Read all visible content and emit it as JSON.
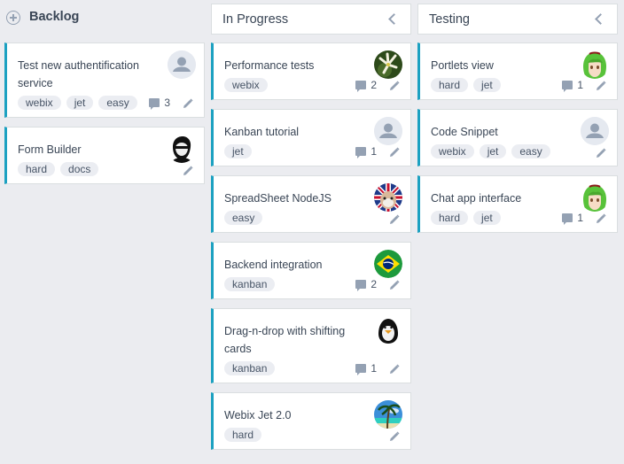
{
  "columns": {
    "backlog": {
      "title": "Backlog",
      "cards": [
        {
          "title": "Test new authentification service",
          "tags": [
            "webix",
            "jet",
            "easy"
          ],
          "comments": "3",
          "avatar": "default-user"
        },
        {
          "title": "Form Builder",
          "tags": [
            "hard",
            "docs"
          ],
          "comments": null,
          "avatar": "user-photo-sunglasses"
        }
      ]
    },
    "in_progress": {
      "title": "In Progress",
      "cards": [
        {
          "title": "Performance tests",
          "tags": [
            "webix"
          ],
          "comments": "2",
          "avatar": "flower-photo"
        },
        {
          "title": "Kanban tutorial",
          "tags": [
            "jet"
          ],
          "comments": "1",
          "avatar": "default-user"
        },
        {
          "title": "SpreadSheet NodeJS",
          "tags": [
            "easy"
          ],
          "comments": null,
          "avatar": "bulldog-photo"
        },
        {
          "title": "Backend integration",
          "tags": [
            "kanban"
          ],
          "comments": "2",
          "avatar": "brazil-flag"
        },
        {
          "title": "Drag-n-drop with shifting cards",
          "tags": [
            "kanban"
          ],
          "comments": "1",
          "avatar": "penguin-photo"
        },
        {
          "title": "Webix Jet 2.0",
          "tags": [
            "hard"
          ],
          "comments": null,
          "avatar": "palm-photo"
        }
      ]
    },
    "testing": {
      "title": "Testing",
      "cards": [
        {
          "title": "Portlets view",
          "tags": [
            "hard",
            "jet"
          ],
          "comments": "1",
          "avatar": "anime-girl"
        },
        {
          "title": "Code Snippet",
          "tags": [
            "webix",
            "jet",
            "easy"
          ],
          "comments": null,
          "avatar": "default-user"
        },
        {
          "title": "Chat app interface",
          "tags": [
            "hard",
            "jet"
          ],
          "comments": "1",
          "avatar": "anime-girl"
        }
      ]
    }
  },
  "colors": {
    "accent": "#1ca1c1",
    "background": "#ebecf0",
    "tag_bg": "#ebedf2",
    "icon": "#94a1b3"
  }
}
